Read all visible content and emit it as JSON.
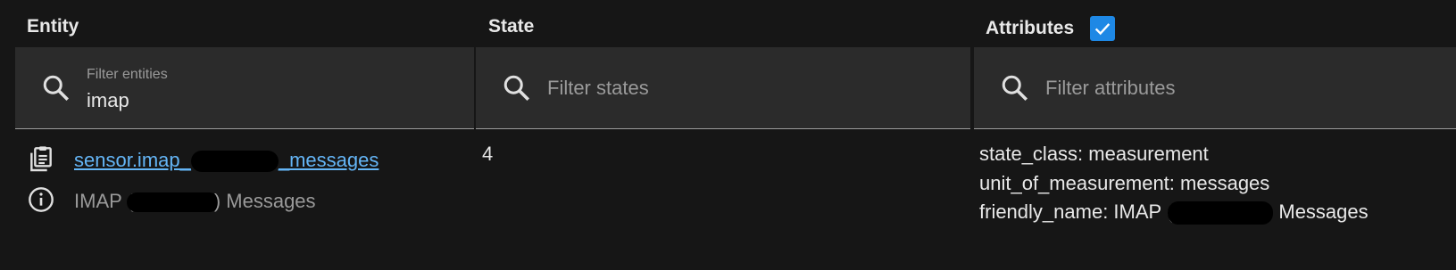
{
  "headers": {
    "entity": "Entity",
    "state": "State",
    "attributes": "Attributes"
  },
  "attributes_checkbox_checked": true,
  "filters": {
    "entity": {
      "label": "Filter entities",
      "value": "imap"
    },
    "state": {
      "placeholder": "Filter states"
    },
    "attributes": {
      "placeholder": "Filter attributes"
    }
  },
  "row": {
    "entity_id_start": "sensor.imap_",
    "entity_id_end": "_messages",
    "friendly_prefix": "IMAP (",
    "friendly_suffix": ") Messages",
    "state": "4",
    "attributes": [
      "state_class: measurement",
      "unit_of_measurement: messages"
    ],
    "friendly_attr_prefix": "friendly_name: IMAP (",
    "friendly_attr_suffix": " Messages"
  },
  "colors": {
    "background": "#161616",
    "filter_bg": "#2b2b2b",
    "link": "#64b5f6",
    "checkbox": "#1e88e5"
  },
  "icons": [
    "search-icon",
    "clipboard-icon",
    "info-icon",
    "checkmark-icon"
  ]
}
